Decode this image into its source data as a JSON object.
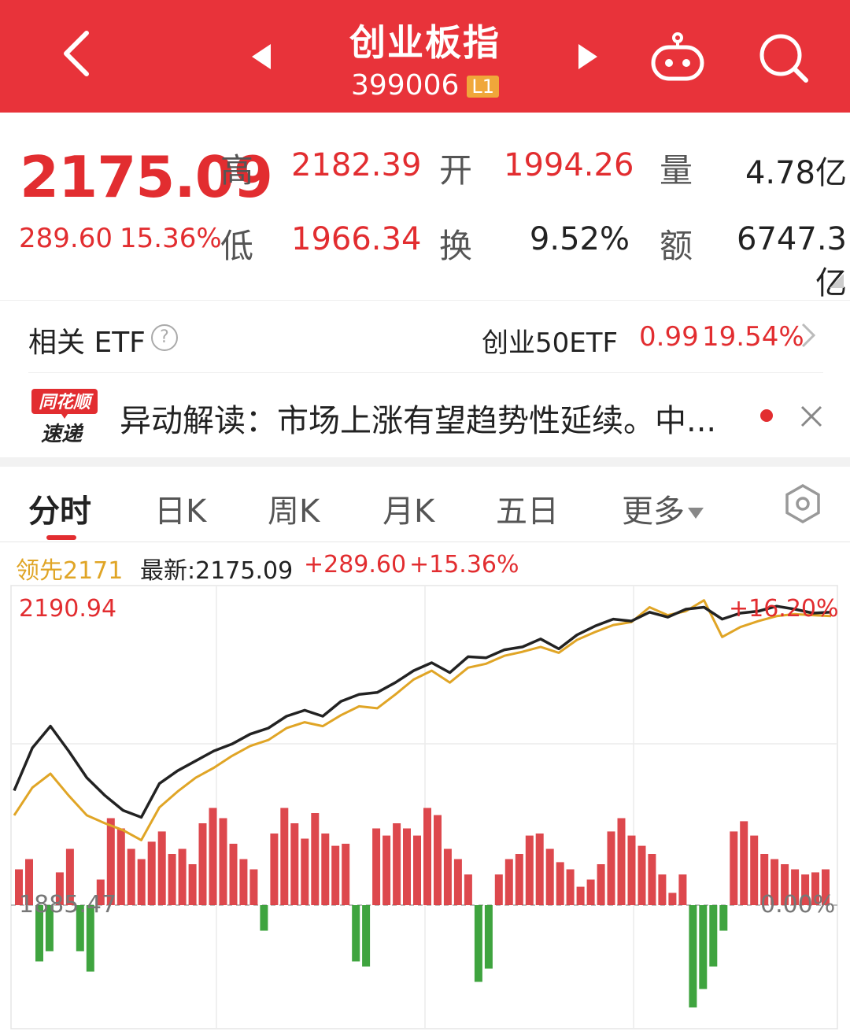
{
  "header": {
    "title": "创业板指",
    "code": "399006",
    "level": "L1"
  },
  "quote": {
    "price": "2175.09",
    "change": "289.60",
    "change_pct": "15.36%",
    "labels": {
      "high": "高",
      "low": "低",
      "open": "开",
      "turnover": "换",
      "volume": "量",
      "amount": "额"
    },
    "high": "2182.39",
    "low": "1966.34",
    "open": "1994.26",
    "turnover_rate": "9.52%",
    "volume": "4.78亿",
    "amount": "6747.3亿"
  },
  "etf": {
    "label": "相关 ETF",
    "help": "?",
    "name": "创业50ETF",
    "price": "0.99",
    "pct": "19.54%"
  },
  "news": {
    "logo_top": "同花顺",
    "logo_bottom": "速递",
    "text": "异动解读：市场上涨有望趋势性延续。中..."
  },
  "tabs": [
    {
      "label": "分时",
      "active": true
    },
    {
      "label": "日K"
    },
    {
      "label": "周K"
    },
    {
      "label": "月K"
    },
    {
      "label": "五日"
    },
    {
      "label": "更多"
    }
  ],
  "chart_info": {
    "leader": "领先2171",
    "latest_label": "最新:2175.09",
    "change": "+289.60",
    "pct": "+15.36%"
  },
  "chart_data": {
    "type": "line",
    "y_max_label": "2190.94",
    "y_ref_label": "1885.47",
    "pct_top_label": "+16.20%",
    "pct_zero_label": "0.00%",
    "colors": {
      "price": "#222222",
      "leader": "#e0a526",
      "up": "#d9343a",
      "down": "#2a9a2a"
    },
    "price": [
      1995,
      2038,
      2060,
      2035,
      2008,
      1990,
      1975,
      1968,
      2002,
      2015,
      2025,
      2035,
      2042,
      2052,
      2058,
      2070,
      2076,
      2070,
      2085,
      2092,
      2094,
      2104,
      2116,
      2124,
      2114,
      2130,
      2129,
      2137,
      2140,
      2148,
      2138,
      2152,
      2161,
      2168,
      2166,
      2175,
      2170,
      2178,
      2180,
      2168,
      2174,
      2176,
      2181,
      2178,
      2174,
      2175
    ],
    "leader": [
      1970,
      1998,
      2012,
      1990,
      1970,
      1962,
      1955,
      1945,
      1978,
      1994,
      2008,
      2018,
      2030,
      2040,
      2046,
      2058,
      2064,
      2060,
      2071,
      2080,
      2078,
      2092,
      2107,
      2116,
      2104,
      2119,
      2123,
      2131,
      2135,
      2140,
      2134,
      2147,
      2155,
      2162,
      2165,
      2180,
      2172,
      2176,
      2187,
      2150,
      2160,
      2166,
      2171,
      2173,
      2172,
      2171
    ],
    "volume": [
      0.35,
      0.45,
      -0.55,
      -0.45,
      0.32,
      0.55,
      -0.45,
      -0.65,
      0.25,
      0.85,
      0.75,
      0.55,
      0.45,
      0.62,
      0.72,
      0.5,
      0.55,
      0.4,
      0.8,
      0.95,
      0.85,
      0.6,
      0.45,
      0.35,
      -0.25,
      0.7,
      0.95,
      0.8,
      0.65,
      0.9,
      0.7,
      0.58,
      0.6,
      -0.55,
      -0.6,
      0.75,
      0.68,
      0.8,
      0.75,
      0.68,
      0.95,
      0.88,
      0.55,
      0.45,
      0.3,
      -0.75,
      -0.62,
      0.3,
      0.45,
      0.5,
      0.68,
      0.7,
      0.55,
      0.42,
      0.35,
      0.18,
      0.25,
      0.4,
      0.72,
      0.85,
      0.68,
      0.58,
      0.5,
      0.3,
      0.12,
      0.3,
      -1.0,
      -0.82,
      -0.6,
      -0.25,
      0.72,
      0.82,
      0.68,
      0.5,
      0.45,
      0.4,
      0.35,
      0.3,
      0.32,
      0.35
    ]
  }
}
